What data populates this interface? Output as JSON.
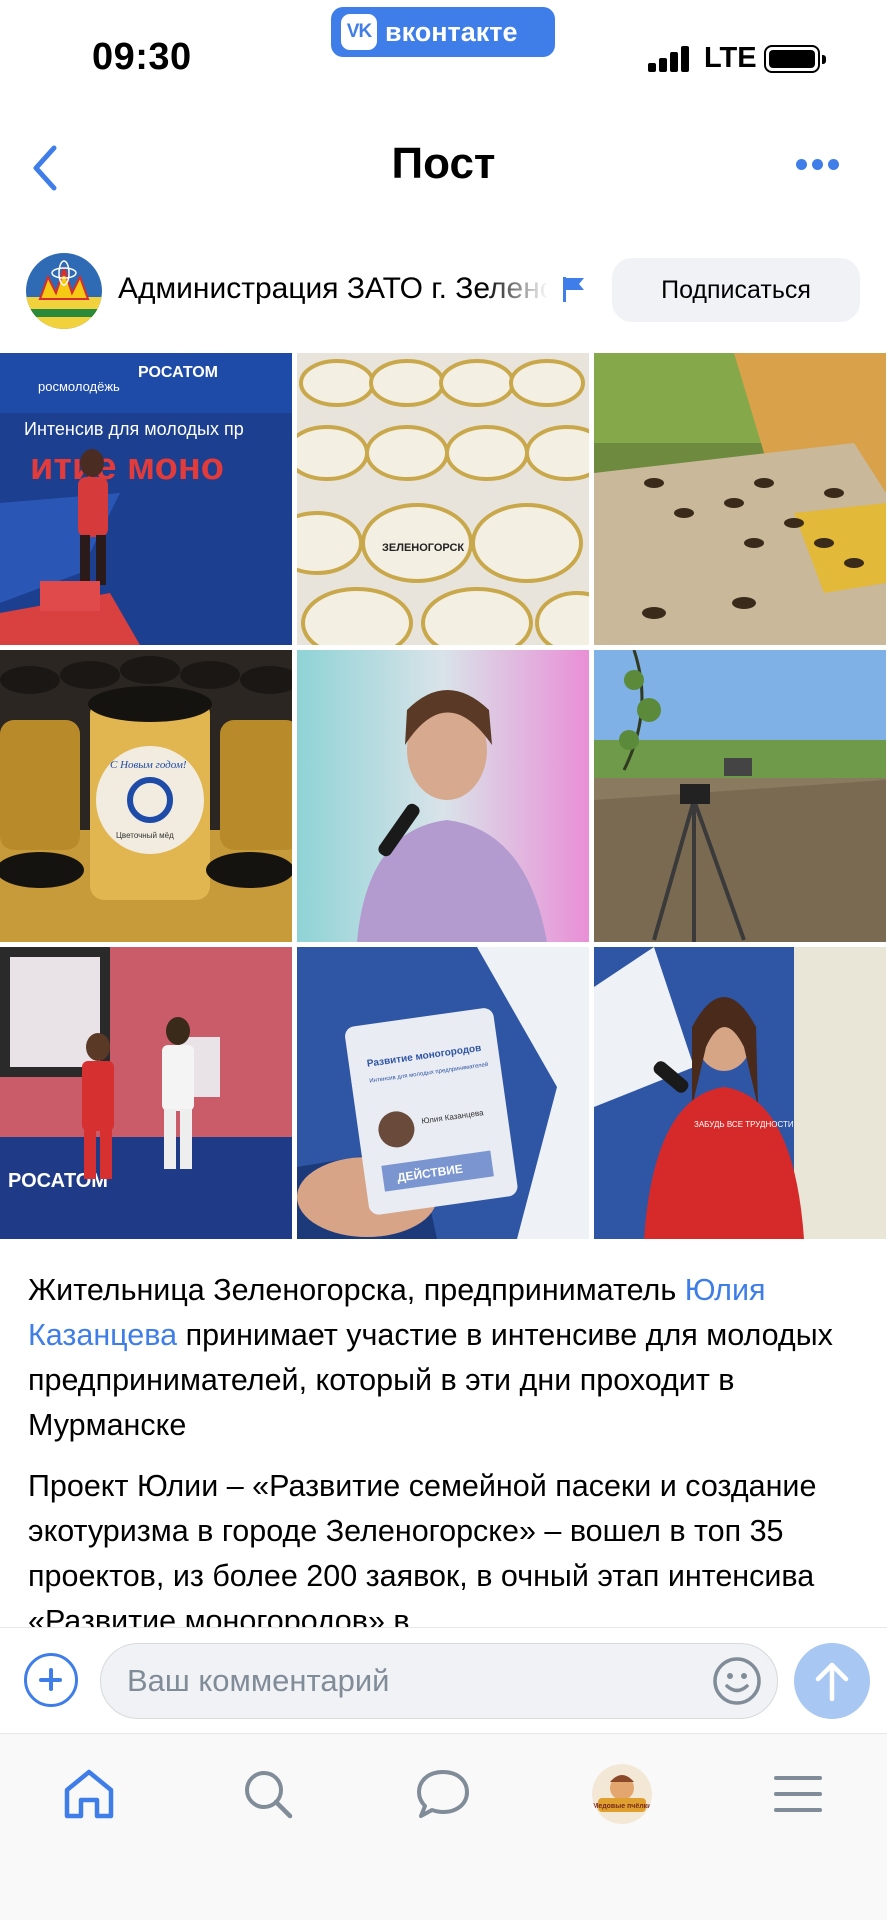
{
  "status_bar": {
    "time": "09:30",
    "carrier_badge": "вконтакте",
    "vk_logo": "VK",
    "network": "LTE"
  },
  "nav": {
    "title": "Пост",
    "back_icon": "chevron-left-icon",
    "more_icon": "more-horizontal-icon"
  },
  "author": {
    "name": "Администрация ЗАТО г. Зеленогорск",
    "subscribe_label": "Подписаться"
  },
  "photos": [
    "Интенсив для молодых предпринимателей — сцена",
    "Банки мёда Зеленогорск",
    "Пчёлы у улья",
    "Цветочный мёд С Новым годом",
    "Девушка с микрофоном",
    "Штатив в поле",
    "Выступление на сцене Росатом",
    "Бейдж Развитие моногородов",
    "Выступление в красной толстовке"
  ],
  "post": {
    "p1_before": "Жительница Зеленогорска, предприниматель ",
    "p1_link": "Юлия Казанцева",
    "p1_after": " принимает участие в интенсиве для молодых предпринимателей, который в эти дни проходит в Мурманске",
    "p2": "Проект Юлии – «Развитие семейной пасеки и создание экотуризма в городе Зеленогорске» – вошел в топ 35 проектов, из более 200 заявок, в очный этап интенсива «Развитие моногородов» в"
  },
  "comment": {
    "placeholder": "Ваш комментарий"
  },
  "photo_text": {
    "rosmolodezh": "росмолодёжь",
    "rosatom": "РОСАТОМ",
    "banner": "Интенсив для молодых пр",
    "banner_big": "итие моно",
    "jar_brand": "ЗЕЛЕНОГОРСК",
    "honey_greeting": "С Новым годом!",
    "honey_label": "Цветочный мёд",
    "stage_brand": "РОСАТОМ",
    "badge_title": "Развитие моногородов",
    "badge_sub": "Интенсив для молодых предпринимателей",
    "badge_name": "Юлия Казанцева",
    "badge_action": "ДЕЙСТВИЕ",
    "shirt_text": "ЗАБУДЬ ВСЕ ТРУДНОСТИ"
  },
  "tabbar": {
    "items": [
      "home-icon",
      "search-icon",
      "messages-icon",
      "profile-avatar",
      "menu-icon"
    ],
    "profile_label": "Медовые пчёлки"
  },
  "colors": {
    "accent": "#3f7ee8",
    "input_bg": "#f0f2f5",
    "send_disabled": "#a8c7f2",
    "tab_icon": "#818c99"
  }
}
